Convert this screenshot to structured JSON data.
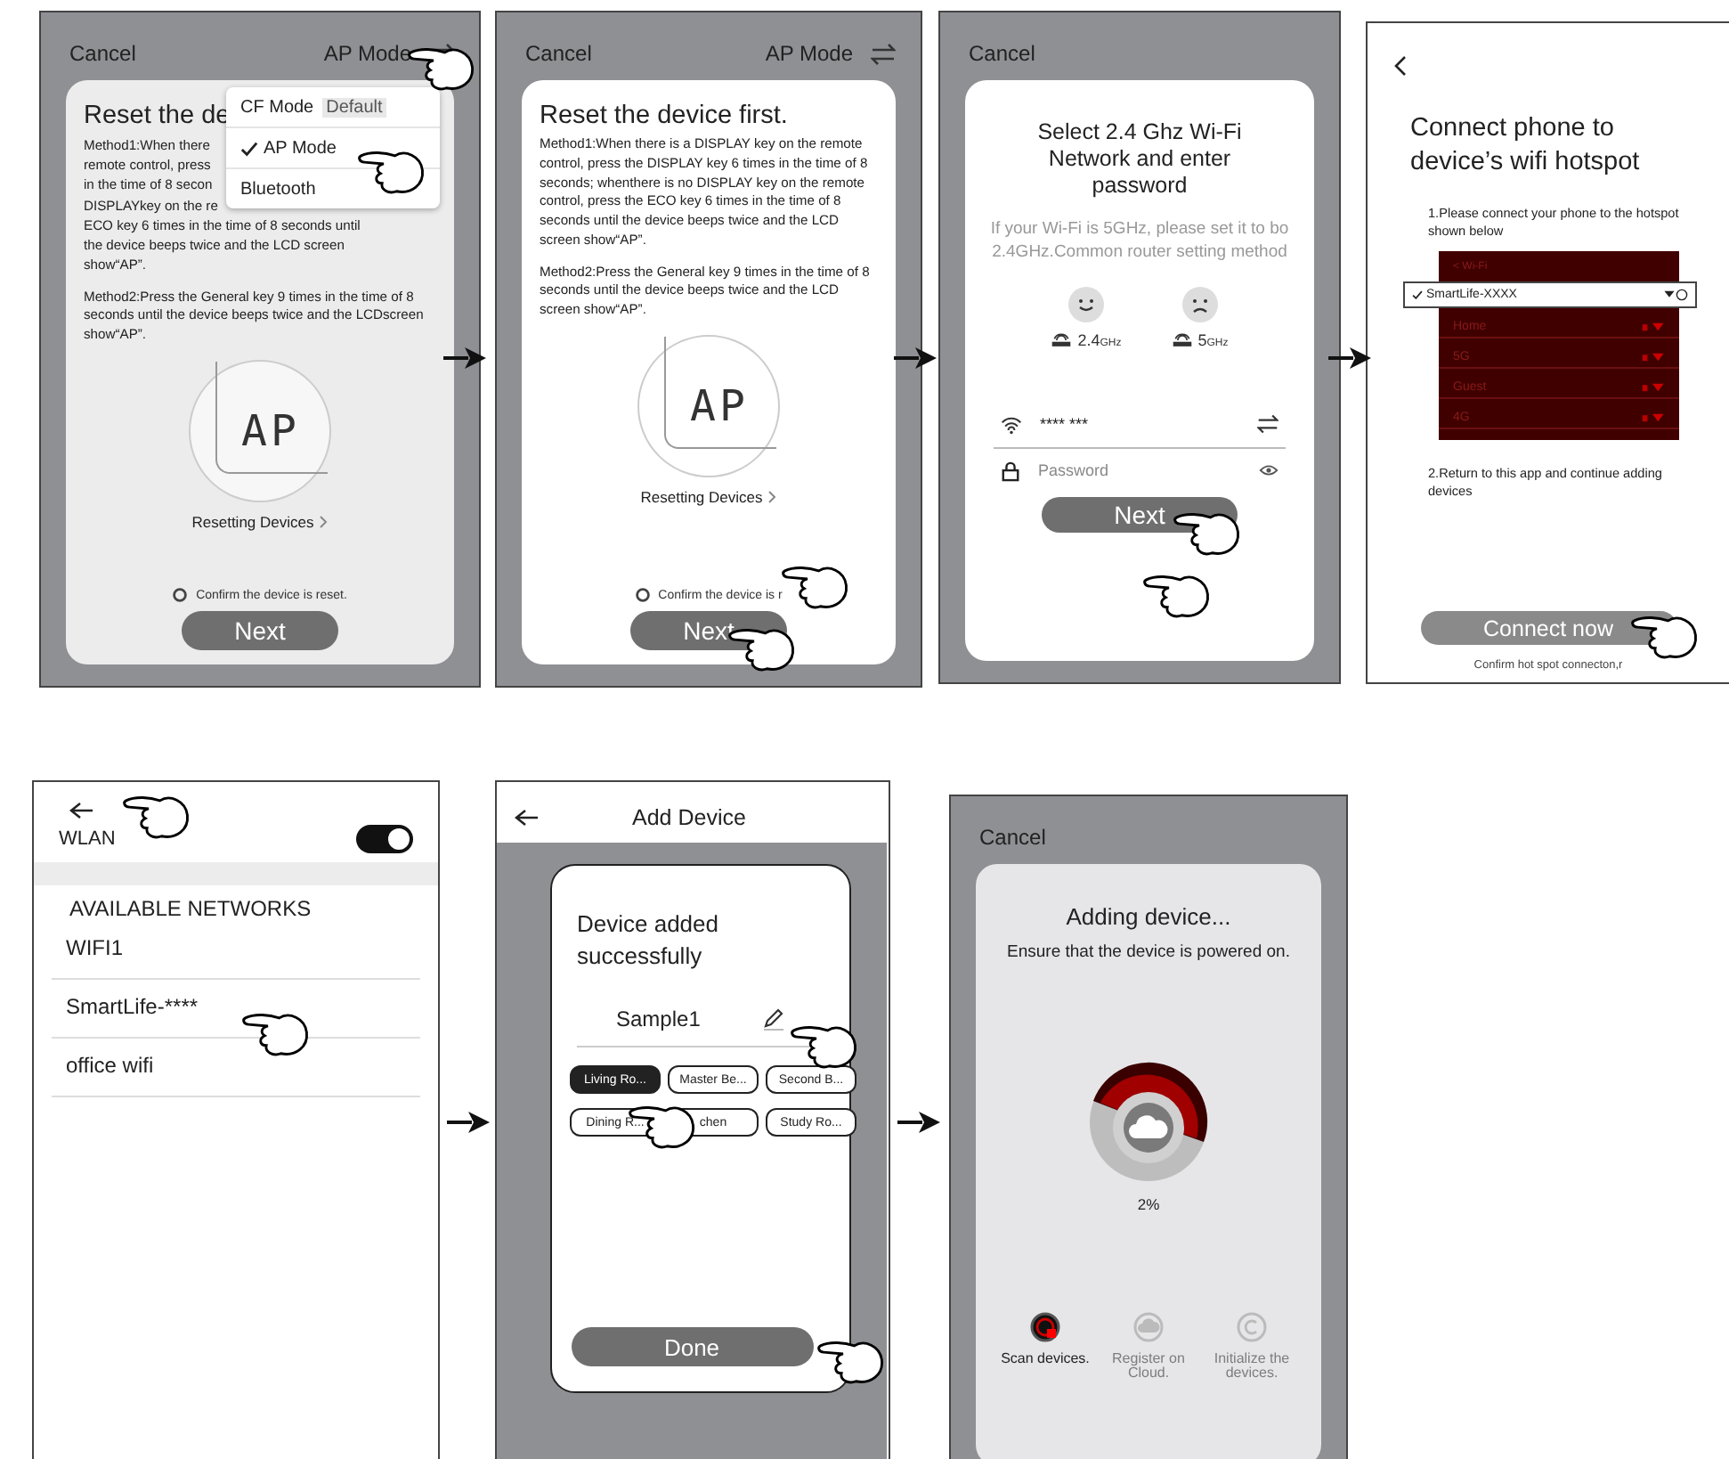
{
  "screens": [
    {
      "kind": "reset",
      "cancel": "Cancel",
      "mode": "AP Mode",
      "title": "Reset the de",
      "method1_lines": [
        "Method1:When there",
        "remote control, press",
        "in the time of 8 secon",
        "DISPLAYkey on the re",
        "ECO key 6 times in the time of 8 seconds until",
        "the device beeps twice and the LCD screen",
        "show“AP”."
      ],
      "method2": "Method2:Press the General key 9 times in the time of 8 seconds until the device beeps twice and the LCDscreen show“AP”.",
      "lcd": "AP",
      "resetting": "Resetting Devices",
      "confirm": "Confirm the device is reset.",
      "next": "Next",
      "menu": [
        {
          "label": "CF Mode",
          "badge": "Default",
          "selected": false
        },
        {
          "label": "AP Mode",
          "selected": true
        },
        {
          "label": "Bluetooth",
          "selected": false
        }
      ]
    },
    {
      "kind": "reset",
      "cancel": "Cancel",
      "mode": "AP Mode",
      "title": "Reset the device first.",
      "method1": "Method1:When there is a DISPLAY key on the remote control, press the DISPLAY key 6 times in the time of 8 seconds; whenthere is no DISPLAY key on the remote control, press the ECO key 6 times in the time of 8 seconds until the device beeps twice and the LCD screen show“AP”.",
      "method2": "Method2:Press the General key 9 times in the time of 8 seconds until the device beeps twice and the LCD screen show“AP”.",
      "lcd": "AP",
      "resetting": "Resetting Devices",
      "confirm": "Confirm the device is r",
      "next": "Next"
    },
    {
      "kind": "wifi",
      "cancel": "Cancel",
      "title": "Select 2.4 Ghz Wi-Fi Network and enter password",
      "hint": "If your Wi-Fi is 5GHz, please set it to bo 2.4GHz.Common router setting method",
      "bands": [
        {
          "value": "2.4",
          "unit": "GHz",
          "ok": true
        },
        {
          "value": "5",
          "unit": "GHz",
          "ok": false
        }
      ],
      "network": "**** ***",
      "password": {
        "placeholder": "Password"
      },
      "next": "Next"
    },
    {
      "kind": "hotspot",
      "title": "Connect phone to device’s wifi hotspot",
      "step1": "1.Please connect your phone to the hotspot shown below",
      "inset": {
        "header": "< Wi-Fi",
        "networks": [
          {
            "name": "SmartLife-XXXX",
            "selected": true
          },
          {
            "name": "Home",
            "selected": false
          },
          {
            "name": "5G",
            "selected": false
          },
          {
            "name": "Guest",
            "selected": false
          },
          {
            "name": "4G",
            "selected": false
          }
        ]
      },
      "step2": "2.Return to this app and continue adding devices",
      "button": "Connect now",
      "footer": "Confirm hot spot connecton,r"
    },
    {
      "kind": "wlan",
      "label": "WLAN",
      "on": true,
      "section": "AVAILABLE NETWORKS",
      "networks": [
        "WIFI1",
        "SmartLife-****",
        "office wifi"
      ]
    },
    {
      "kind": "added",
      "title": "Add Device",
      "heading": "Device added successfully",
      "device_name": "Sample1",
      "rooms": [
        {
          "label": "Living Ro...",
          "selected": true
        },
        {
          "label": "Master Be...",
          "selected": false
        },
        {
          "label": "Second B...",
          "selected": false
        },
        {
          "label": "Dining R...",
          "selected": false
        },
        {
          "label": "chen",
          "selected": false
        },
        {
          "label": "Study Ro...",
          "selected": false
        }
      ],
      "done": "Done"
    },
    {
      "kind": "adding",
      "cancel": "Cancel",
      "title": "Adding device...",
      "subtitle": "Ensure that the device is powered on.",
      "percent": "2%",
      "steps": [
        {
          "label": "Scan devices.",
          "active": true
        },
        {
          "label": "Register on Cloud.",
          "active": false
        },
        {
          "label": "Initialize the devices.",
          "active": false
        }
      ]
    }
  ]
}
